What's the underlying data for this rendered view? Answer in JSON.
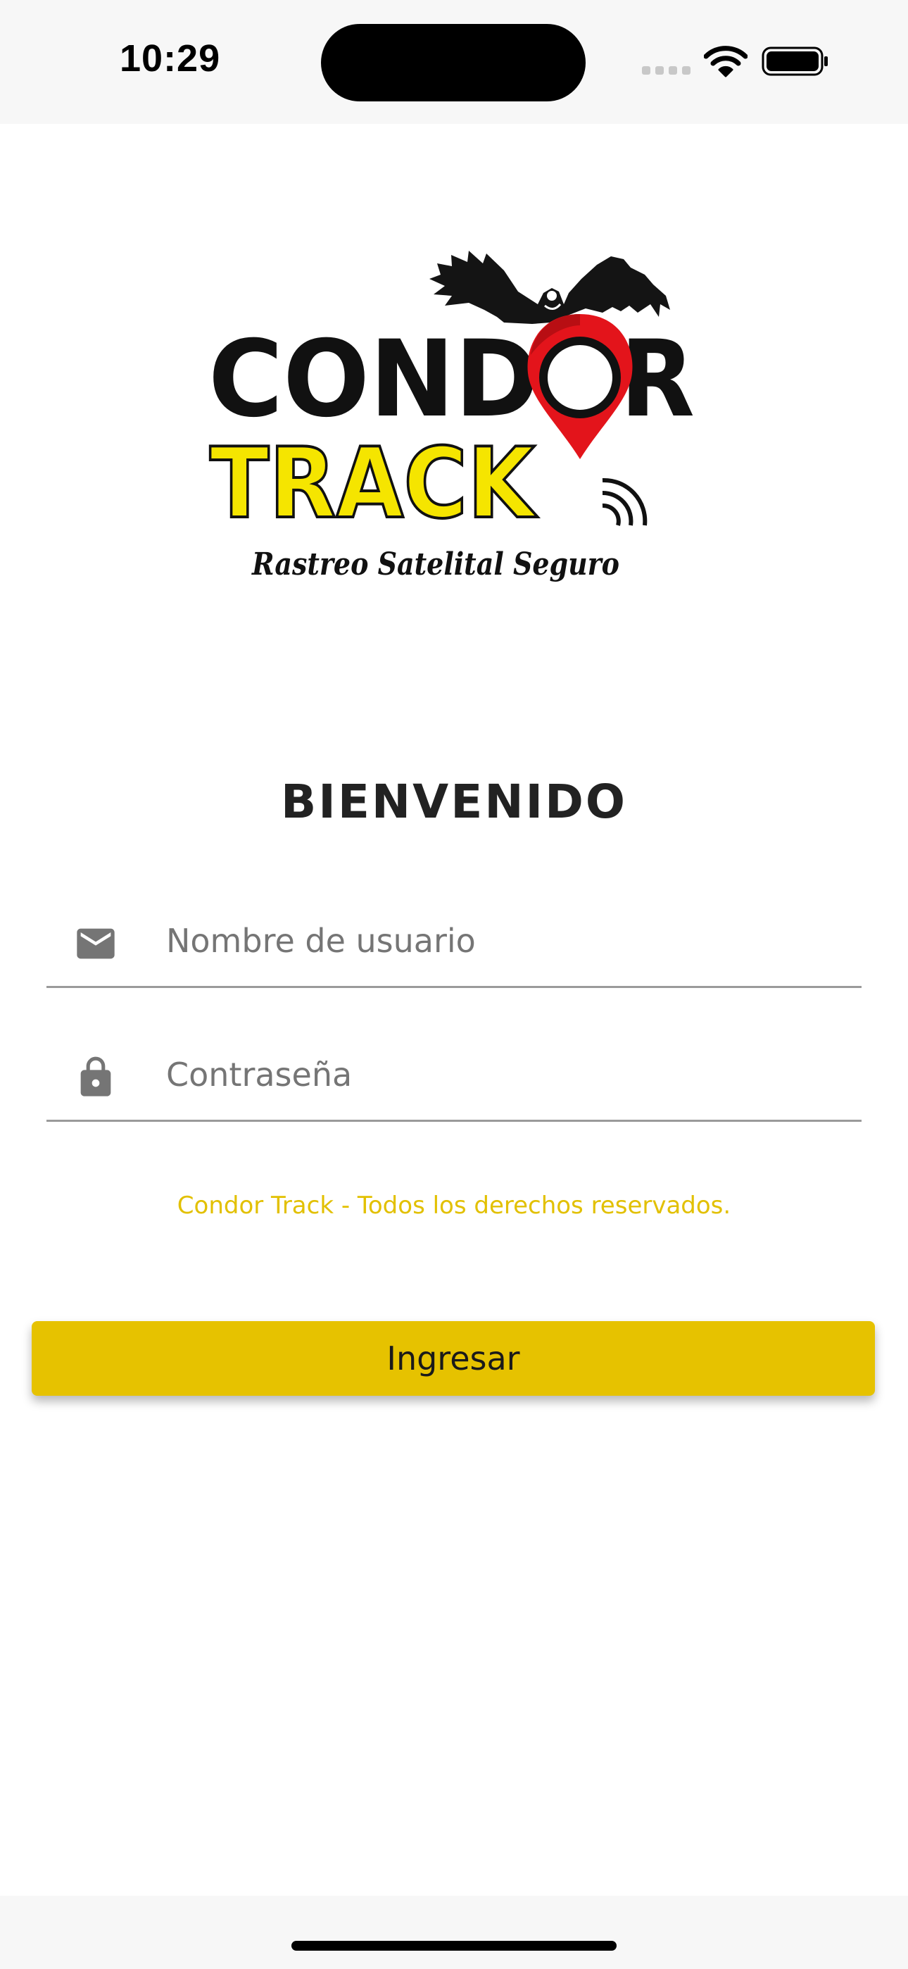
{
  "status_bar": {
    "time": "10:29",
    "icons": [
      "cell-signal-icon",
      "wifi-icon",
      "battery-icon"
    ]
  },
  "logo": {
    "line1": "CONDOR",
    "line2": "TRACK",
    "tagline": "Rastreo Satelital Seguro",
    "icons": [
      "condor-icon",
      "map-pin-icon",
      "signal-waves-icon"
    ]
  },
  "login": {
    "title": "BIENVENIDO",
    "username": {
      "icon": "mail-icon",
      "placeholder": "Nombre de usuario",
      "value": ""
    },
    "password": {
      "icon": "lock-icon",
      "placeholder": "Contraseña",
      "value": ""
    },
    "copyright": "Condor Track - Todos los derechos reservados.",
    "submit_label": "Ingresar"
  },
  "colors": {
    "accent": "#e6c200",
    "copyright_text": "#e2c000",
    "logo_yellow": "#f5e500",
    "logo_red": "#e3141b",
    "title_text": "#222222",
    "icon_gray": "#757575"
  }
}
